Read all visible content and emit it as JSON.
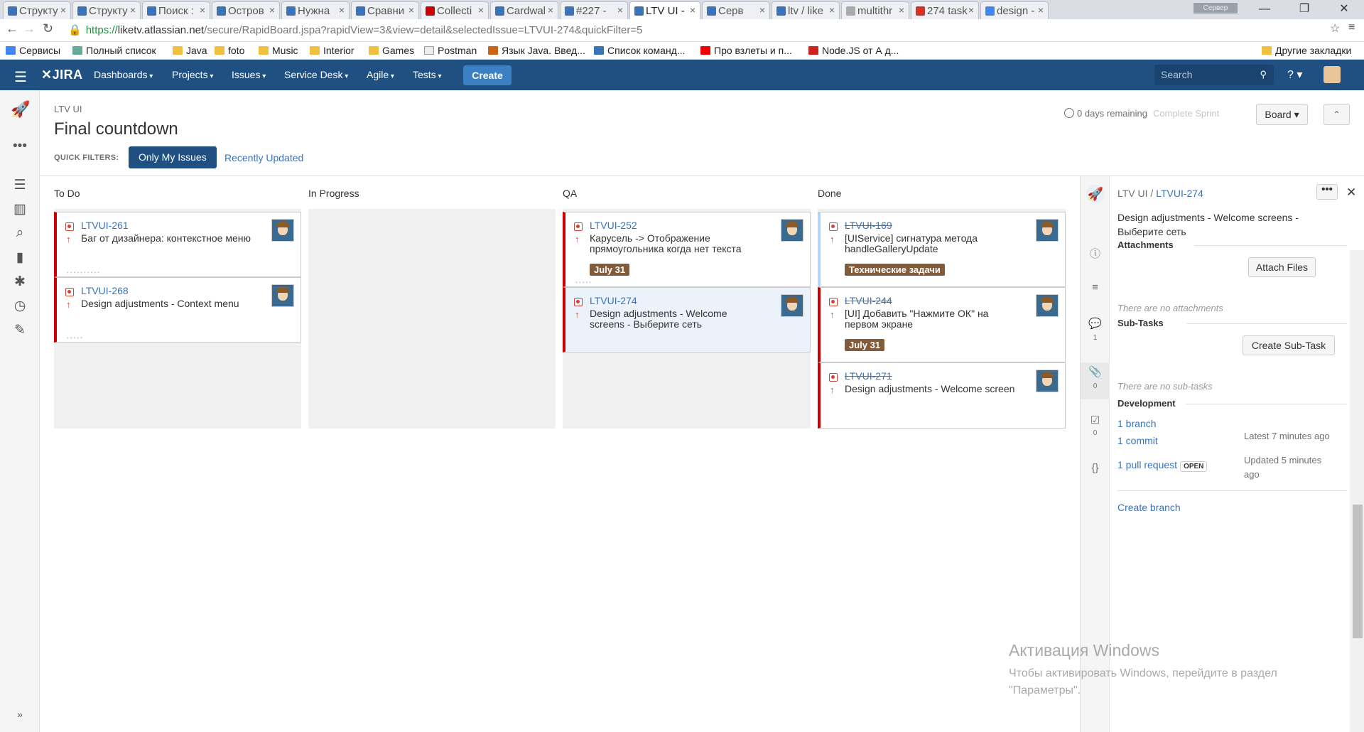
{
  "browser": {
    "tabs": [
      {
        "label": "Структу"
      },
      {
        "label": "Структу"
      },
      {
        "label": "Поиск :"
      },
      {
        "label": "Остров"
      },
      {
        "label": "Нужна"
      },
      {
        "label": "Сравни"
      },
      {
        "label": "Collecti"
      },
      {
        "label": "Cardwal"
      },
      {
        "label": "#227 - "
      },
      {
        "label": "LTV UI -"
      },
      {
        "label": "Серв"
      },
      {
        "label": "ltv / like"
      },
      {
        "label": "multithr"
      },
      {
        "label": "274 task"
      },
      {
        "label": "design -"
      }
    ],
    "server_badge": "Сервер",
    "url_scheme": "https://",
    "url_host": "liketv.atlassian.net",
    "url_path": "/secure/RapidBoard.jspa?rapidView=3&view=detail&selectedIssue=LTVUI-274&quickFilter=5",
    "bookmarks": [
      "Сервисы",
      "Полный список",
      "Java",
      "foto",
      "Music",
      "Interior",
      "Games",
      "Postman",
      "Язык Java. Введ...",
      "Список команд...",
      "Про взлеты и п...",
      "Node.JS от А д..."
    ],
    "other_bookmarks": "Другие закладки"
  },
  "header": {
    "logo": "JIRA",
    "nav": [
      "Dashboards",
      "Projects",
      "Issues",
      "Service Desk",
      "Agile",
      "Tests"
    ],
    "create": "Create",
    "search_placeholder": "Search"
  },
  "board": {
    "project": "LTV UI",
    "title": "Final countdown",
    "quick_filters_label": "QUICK FILTERS:",
    "filter_active": "Only My Issues",
    "filter_other": "Recently Updated",
    "days_remaining": "0 days remaining",
    "complete_sprint": "Complete Sprint",
    "board_button": "Board",
    "columns": [
      "To Do",
      "In Progress",
      "QA",
      "Done"
    ],
    "cards": [
      {
        "key": "LTVUI-261",
        "summary": "Баг от дизайнера: контекстное меню"
      },
      {
        "key": "LTVUI-268",
        "summary": "Design adjustments - Context menu"
      },
      {
        "key": "LTVUI-252",
        "summary": "Карусель -> Отображение прямоугольника когда нет текста",
        "epic": "July 31"
      },
      {
        "key": "LTVUI-274",
        "summary": "Design adjustments - Welcome screens - Выберите сеть"
      },
      {
        "key": "LTVUI-169",
        "summary": "[UIService] сигнатура метода handleGalleryUpdate",
        "epic": "Технические задачи"
      },
      {
        "key": "LTVUI-244",
        "summary": "[UI] Добавить \"Нажмите ОК\" на первом экране",
        "epic": "July 31"
      },
      {
        "key": "LTVUI-271",
        "summary": "Design adjustments - Welcome screen"
      }
    ]
  },
  "detail": {
    "project": "LTV UI",
    "separator": "/",
    "issue_key": "LTVUI-274",
    "summary": "Design adjustments - Welcome screens - Выберите сеть",
    "more": "•••",
    "comments_count": "1",
    "attachments_count": "0",
    "subtasks_count": "0",
    "attachments_title": "Attachments",
    "attach_files": "Attach Files",
    "no_attachments": "There are no attachments",
    "subtasks_title": "Sub-Tasks",
    "create_subtask": "Create Sub-Task",
    "no_subtasks": "There are no sub-tasks",
    "development_title": "Development",
    "branch": "1 branch",
    "commit": "1 commit",
    "commit_meta": "Latest 7 minutes ago",
    "pull_request": "1 pull request",
    "pr_status": "OPEN",
    "pr_meta": "Updated 5 minutes ago",
    "create_branch": "Create branch"
  },
  "watermark": {
    "title": "Активация Windows",
    "text": "Чтобы активировать Windows, перейдите в раздел \"Параметры\"."
  }
}
